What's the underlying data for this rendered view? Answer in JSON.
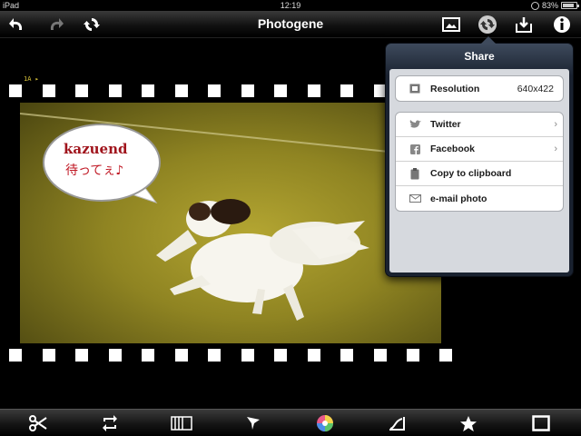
{
  "status_bar": {
    "carrier": "iPad",
    "time": "12:19",
    "battery": "83%"
  },
  "toolbar": {
    "title": "Photogene",
    "buttons": [
      "undo-icon",
      "redo-icon",
      "reset-icon",
      "photo-icon",
      "share-icon",
      "save-icon",
      "info-icon"
    ]
  },
  "photo": {
    "film_code": "1A ▸",
    "bubble_line1": "kazuend",
    "bubble_line2": "待ってぇ♪"
  },
  "share_popover": {
    "title": "Share",
    "resolution": {
      "label": "Resolution",
      "value": "640x422",
      "icon": "resolution-icon"
    },
    "items": [
      {
        "label": "Twitter",
        "icon": "twitter-icon",
        "has_chevron": true
      },
      {
        "label": "Facebook",
        "icon": "facebook-icon",
        "has_chevron": true
      },
      {
        "label": "Copy to clipboard",
        "icon": "clipboard-icon",
        "has_chevron": false
      },
      {
        "label": "e-mail photo",
        "icon": "mail-icon",
        "has_chevron": false
      }
    ]
  },
  "bottom_toolbar": {
    "buttons": [
      "crop-icon",
      "rotate-icon",
      "frame-icon",
      "filter-icon",
      "color-icon",
      "curves-icon",
      "star-icon",
      "border-icon"
    ]
  },
  "colors": {
    "toolbar_bg": "#1a1a1a",
    "popover_bg": "#1a2230",
    "bubble_text": "#a0141c",
    "grass": "#8f8422"
  }
}
